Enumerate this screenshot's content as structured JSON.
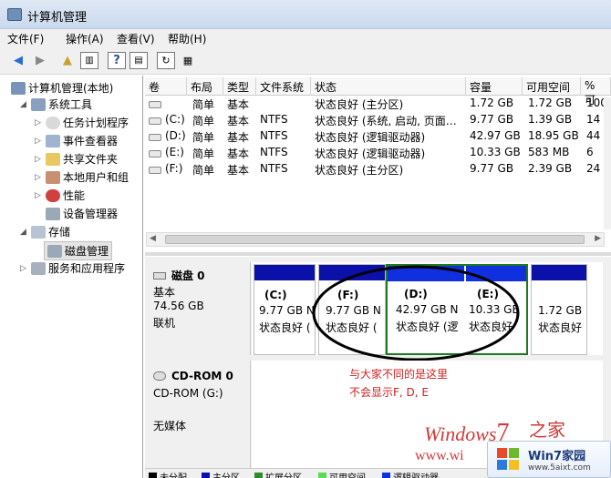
{
  "window": {
    "title": "计算机管理"
  },
  "menu": [
    "文件(F)",
    "操作(A)",
    "查看(V)",
    "帮助(H)"
  ],
  "tree": {
    "root": "计算机管理(本地)",
    "system_tools": "系统工具",
    "task_scheduler": "任务计划程序",
    "event_viewer": "事件查看器",
    "shared_folders": "共享文件夹",
    "local_users": "本地用户和组",
    "performance": "性能",
    "device_manager": "设备管理器",
    "storage": "存储",
    "disk_management": "磁盘管理",
    "services_apps": "服务和应用程序"
  },
  "volumes": {
    "columns": [
      "卷",
      "布局",
      "类型",
      "文件系统",
      "状态",
      "容量",
      "可用空间",
      "% 可"
    ],
    "rows": [
      {
        "vol": "",
        "layout": "简单",
        "type": "基本",
        "fs": "",
        "status": "状态良好 (主分区)",
        "cap": "1.72 GB",
        "free": "1.72 GB",
        "pct": "100"
      },
      {
        "vol": "(C:)",
        "layout": "简单",
        "type": "基本",
        "fs": "NTFS",
        "status": "状态良好 (系统, 启动, 页面…",
        "cap": "9.77 GB",
        "free": "1.39 GB",
        "pct": "14"
      },
      {
        "vol": "(D:)",
        "layout": "简单",
        "type": "基本",
        "fs": "NTFS",
        "status": "状态良好 (逻辑驱动器)",
        "cap": "42.97 GB",
        "free": "18.95 GB",
        "pct": "44"
      },
      {
        "vol": "(E:)",
        "layout": "简单",
        "type": "基本",
        "fs": "NTFS",
        "status": "状态良好 (逻辑驱动器)",
        "cap": "10.33 GB",
        "free": "583 MB",
        "pct": "6"
      },
      {
        "vol": "(F:)",
        "layout": "简单",
        "type": "基本",
        "fs": "NTFS",
        "status": "状态良好 (主分区)",
        "cap": "9.77 GB",
        "free": "2.39 GB",
        "pct": "24"
      }
    ]
  },
  "disk0": {
    "name": "磁盘 0",
    "type": "基本",
    "size": "74.56 GB",
    "status": "联机"
  },
  "partitions": [
    {
      "label": "(C:)",
      "size": "9.77 GB N",
      "status": "状态良好 ("
    },
    {
      "label": "(F:)",
      "size": "9.77 GB N",
      "status": "状态良好 ("
    },
    {
      "label": "(D:)",
      "size": "42.97 GB N",
      "status": "状态良好 (逻"
    },
    {
      "label": "(E:)",
      "size": "10.33 GB",
      "status": "状态良好"
    },
    {
      "label": "",
      "size": "1.72 GB",
      "status": "状态良好"
    }
  ],
  "cdrom": {
    "name": "CD-ROM 0",
    "type": "CD-ROM (G:)",
    "status": "无媒体"
  },
  "annotation": {
    "line1": "与大家不同的是这里",
    "line2": "不会显示F, D, E"
  },
  "legend": [
    "未分配",
    "主分区",
    "扩展分区",
    "可用空间",
    "逻辑驱动器"
  ],
  "colors": {
    "unallocated": "#000000",
    "primary": "#0a10a8",
    "extended": "#2e8b2e",
    "free": "#55dd55",
    "logical": "#1030e0",
    "annotation": "#cc2222"
  },
  "watermark": {
    "brand": "Windows",
    "seven": "7",
    "suffix": "之家",
    "url": "www.wi",
    "badge_name": "Win7家园",
    "badge_url": "www.5aixt.com"
  }
}
